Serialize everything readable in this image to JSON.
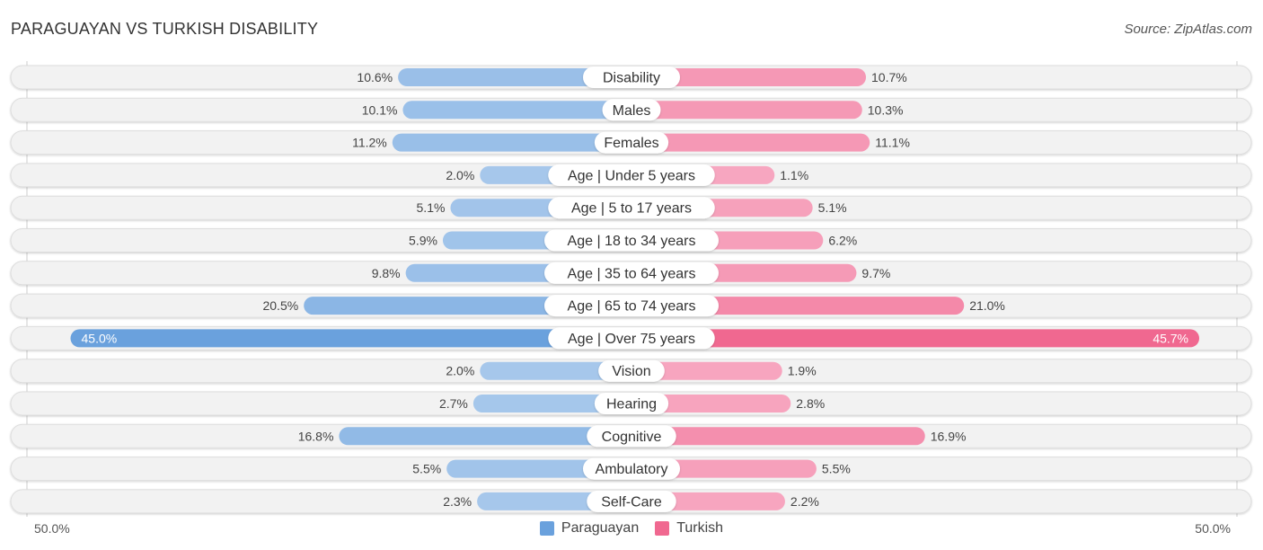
{
  "header": {
    "title": "PARAGUAYAN VS TURKISH DISABILITY",
    "source": "Source: ZipAtlas.com"
  },
  "colors": {
    "paraguayan": "#6aa1dd",
    "paraguayan_light": "#a9c9ec",
    "turkish": "#f06890",
    "turkish_light": "#f7a8c1",
    "row_bg": "#f2f2f2",
    "row_border": "#dddddd"
  },
  "axis": {
    "left_label": "50.0%",
    "right_label": "50.0%"
  },
  "legend": [
    {
      "name": "Paraguayan",
      "color_key": "paraguayan"
    },
    {
      "name": "Turkish",
      "color_key": "turkish"
    }
  ],
  "chart_data": {
    "type": "bar",
    "orientation": "horizontal-diverging",
    "title": "PARAGUAYAN VS TURKISH DISABILITY",
    "xlim": [
      0,
      50
    ],
    "categories": [
      "Disability",
      "Males",
      "Females",
      "Age | Under 5 years",
      "Age | 5 to 17 years",
      "Age | 18 to 34 years",
      "Age | 35 to 64 years",
      "Age | 65 to 74 years",
      "Age | Over 75 years",
      "Vision",
      "Hearing",
      "Cognitive",
      "Ambulatory",
      "Self-Care"
    ],
    "series": [
      {
        "name": "Paraguayan",
        "side": "left",
        "values": [
          10.6,
          10.1,
          11.2,
          2.0,
          5.1,
          5.9,
          9.8,
          20.5,
          45.0,
          2.0,
          2.7,
          16.8,
          5.5,
          2.3
        ],
        "labels": [
          "10.6%",
          "10.1%",
          "11.2%",
          "2.0%",
          "5.1%",
          "5.9%",
          "9.8%",
          "20.5%",
          "45.0%",
          "2.0%",
          "2.7%",
          "16.8%",
          "5.5%",
          "2.3%"
        ]
      },
      {
        "name": "Turkish",
        "side": "right",
        "values": [
          10.7,
          10.3,
          11.1,
          1.1,
          5.1,
          6.2,
          9.7,
          21.0,
          45.7,
          1.9,
          2.8,
          16.9,
          5.5,
          2.2
        ],
        "labels": [
          "10.7%",
          "10.3%",
          "11.1%",
          "1.1%",
          "5.1%",
          "6.2%",
          "9.7%",
          "21.0%",
          "45.7%",
          "1.9%",
          "2.8%",
          "16.9%",
          "5.5%",
          "2.2%"
        ]
      }
    ],
    "legend_position": "bottom-center",
    "grid": false
  }
}
